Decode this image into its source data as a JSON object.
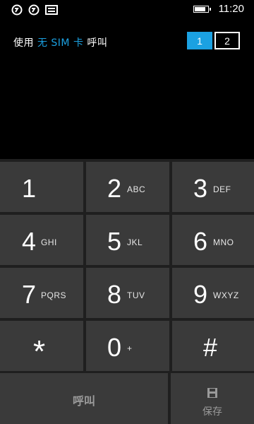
{
  "status_bar": {
    "icons": [
      "sim1-signal-icon",
      "sim2-signal-icon",
      "message-icon"
    ],
    "time": "11:20",
    "battery_level": 0.85
  },
  "sim_info": {
    "prefix": "使用",
    "highlight": "无 SIM 卡",
    "suffix": "呼叫",
    "sim_buttons": [
      "1",
      "2"
    ],
    "active_sim": "1",
    "accent_color": "#1ba1e2"
  },
  "dialpad": {
    "keys": [
      {
        "digit": "1",
        "letters": ""
      },
      {
        "digit": "2",
        "letters": "ABC"
      },
      {
        "digit": "3",
        "letters": "DEF"
      },
      {
        "digit": "4",
        "letters": "GHI"
      },
      {
        "digit": "5",
        "letters": "JKL"
      },
      {
        "digit": "6",
        "letters": "MNO"
      },
      {
        "digit": "7",
        "letters": "PQRS"
      },
      {
        "digit": "8",
        "letters": "TUV"
      },
      {
        "digit": "9",
        "letters": "WXYZ"
      },
      {
        "digit": "*",
        "letters": ""
      },
      {
        "digit": "0",
        "letters": "+"
      },
      {
        "digit": "#",
        "letters": ""
      }
    ],
    "call_label": "呼叫",
    "save_label": "保存"
  }
}
